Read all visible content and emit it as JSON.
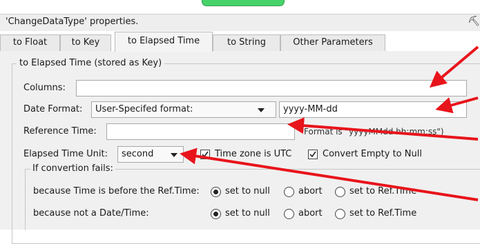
{
  "dialog": {
    "title": "'ChangeDataType' properties.",
    "pin_icon": "pin-icon"
  },
  "tabs": [
    {
      "label": "to Float"
    },
    {
      "label": "to Key"
    },
    {
      "label": "to Elapsed Time"
    },
    {
      "label": "to String"
    },
    {
      "label": "Other Parameters"
    }
  ],
  "active_tab": "to Elapsed Time",
  "group": {
    "title": "to Elapsed Time (stored as Key)",
    "columns_label": "Columns:",
    "columns_value": "",
    "date_format_label": "Date Format:",
    "date_format_selected": "User-Specifed format:",
    "date_format_value": "yyyy-MM-dd",
    "reference_time_label": "Reference Time:",
    "reference_time_value": "",
    "reference_time_hint": "Format is \"yyyyMMdd hh:mm:ss\")",
    "elapsed_unit_label": "Elapsed Time Unit:",
    "elapsed_unit_selected": "second",
    "utc_label": "Time zone is UTC",
    "utc_checked": true,
    "empty_null_label": "Convert Empty to Null",
    "empty_null_checked": true
  },
  "failure": {
    "title": "If convertion fails:",
    "rows": [
      {
        "label": "because Time is before the Ref.Time:",
        "options": [
          "set to null",
          "abort",
          "set to Ref.Time"
        ],
        "selected": 0
      },
      {
        "label": "because not a Date/Time:",
        "options": [
          "set to null",
          "abort",
          "set to Ref.Time"
        ],
        "selected": 0
      }
    ]
  },
  "annotation_color": "#e8141b"
}
